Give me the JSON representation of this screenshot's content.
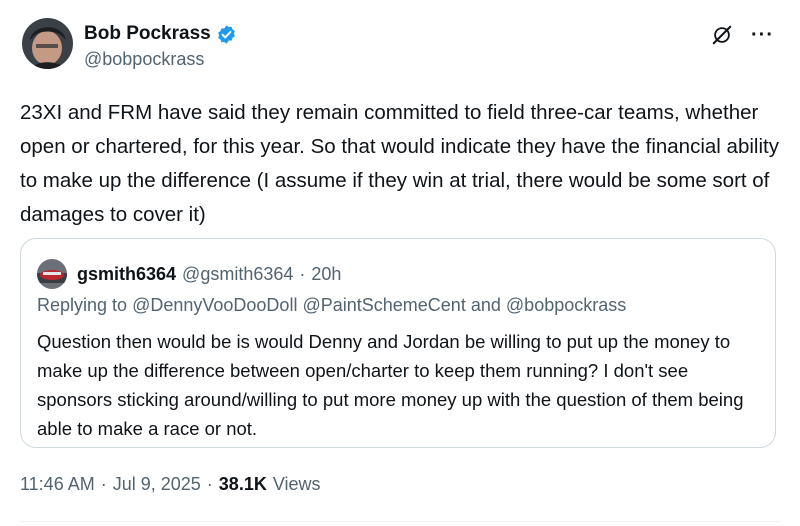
{
  "tweet": {
    "author": {
      "display_name": "Bob Pockrass",
      "handle": "@bobpockrass",
      "verified": true
    },
    "text": "23XI and FRM have said they remain committed to field three-car teams, whether open or chartered, for this year. So that would indicate they have the financial ability to make up the difference (I assume if they win at trial, there would be some sort of damages to cover it)",
    "time": "11:46 AM",
    "date": "Jul 9, 2025",
    "separator": "·",
    "views_count": "38.1K",
    "views_label": "Views"
  },
  "quote": {
    "display_name": "gsmith6364",
    "handle": "@gsmith6364",
    "separator": "·",
    "time": "20h",
    "reply_prefix": "Replying to",
    "mentions": [
      "@DennyVooDooDoll",
      "@PaintSchemeCent",
      "and",
      "@bobpockrass"
    ],
    "text": "Question then would be is would Denny and Jordan be willing to put up the money to make up the difference between open/charter to keep them running? I don't see sponsors sticking around/willing to put more money up with the question of them being able to make a race or not."
  },
  "icons": {
    "verified": "verified-badge-icon",
    "grok": "grok-icon",
    "more": "more-icon"
  },
  "colors": {
    "accent": "#1d9bf0",
    "text": "#0f1419",
    "secondary": "#536471",
    "border": "#cfd9de"
  }
}
